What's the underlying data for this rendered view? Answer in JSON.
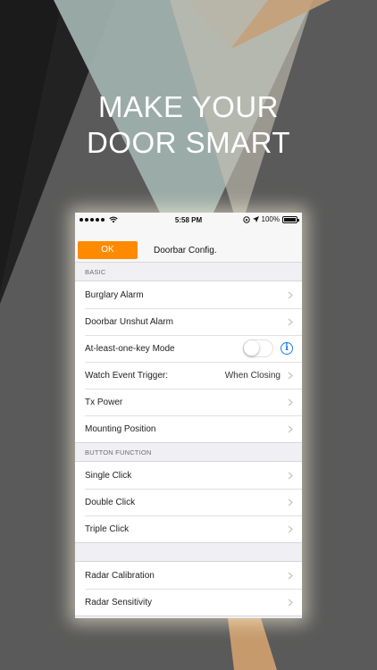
{
  "headline": {
    "line1": "MAKE YOUR",
    "line2": "DOOR SMART"
  },
  "colors": {
    "background": "#5a5a5a",
    "accent": "#ff8a00",
    "info_blue": "#1a7ff0"
  },
  "status_bar": {
    "time": "5:58 PM",
    "battery": "100%",
    "icons": [
      "signal-dots-icon",
      "wifi-icon",
      "orientation-lock-icon",
      "location-arrow-icon",
      "battery-icon"
    ]
  },
  "nav": {
    "ok_label": "OK",
    "title": "Doorbar Config."
  },
  "sections": {
    "basic": {
      "header": "BASIC",
      "rows": {
        "burglary_alarm": "Burglary Alarm",
        "doorbar_unshut_alarm": "Doorbar Unshut Alarm",
        "at_least_one_key_mode": "At-least-one-key Mode",
        "watch_event_trigger": "Watch Event Trigger:",
        "watch_event_trigger_value": "When Closing",
        "tx_power": "Tx Power",
        "mounting_position": "Mounting Position"
      },
      "at_least_one_key_mode_enabled": false
    },
    "button_function": {
      "header": "BUTTON FUNCTION",
      "rows": {
        "single_click": "Single Click",
        "double_click": "Double Click",
        "triple_click": "Triple Click"
      }
    },
    "radar": {
      "rows": {
        "radar_calibration": "Radar Calibration",
        "radar_sensitivity": "Radar Sensitivity"
      }
    }
  }
}
